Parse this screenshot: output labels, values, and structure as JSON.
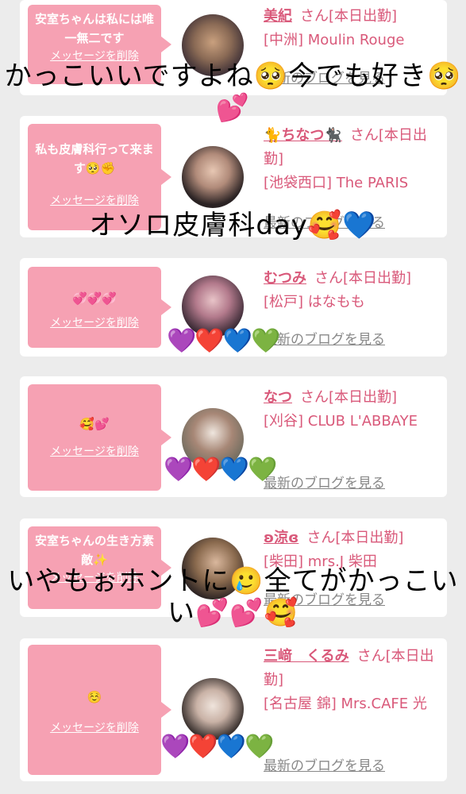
{
  "rows": [
    {
      "message": "安室ちゃんは私には唯一無二です",
      "delete_label": "メッセージを削除",
      "name": "美紀",
      "san": "さん[本日出勤]",
      "shop": "[中洲] Moulin Rouge",
      "blog": "最新のブログを見る"
    },
    {
      "message": "私も皮膚科行って来ます🥺✊",
      "delete_label": "メッセージを削除",
      "name": "🐈ちなつ🐈‍⬛",
      "san": "さん[本日出勤]",
      "shop": "[池袋西口] The PARIS",
      "blog": "最新のブログを見る"
    },
    {
      "message": "💞💞💞",
      "delete_label": "メッセージを削除",
      "name": "むつみ",
      "san": "さん[本日出勤]",
      "shop": "[松戸] はなもも",
      "blog": "最新のブログを見る"
    },
    {
      "message": "🥰💕",
      "delete_label": "メッセージを削除",
      "name": "なつ",
      "san": "さん[本日出勤]",
      "shop": "[刈谷] CLUB L'ABBAYE",
      "blog": "最新のブログを見る"
    },
    {
      "message": "安室ちゃんの生き方素敵✨",
      "delete_label": "メッセージを削除",
      "name": "ʚ涼ɞ",
      "san": "さん[本日出勤]",
      "shop": "[柴田] mrs.J 柴田",
      "blog": "最新のブログを見る"
    },
    {
      "message": "☺️",
      "delete_label": "メッセージを削除",
      "name": "三﨑　くるみ",
      "san": "さん[本日出勤]",
      "shop": "[名古屋 錦] Mrs.CAFE 光",
      "blog": "最新のブログを見る"
    }
  ],
  "overlays": {
    "caption1": "かっこいいですよね🥺今でも好き🥺💕",
    "caption2": "オソロ皮膚科day🥰💙",
    "caption3": "いやもぉホントに🥲全てがかっこいい💕💕🥰",
    "hearts": "💜❤️💙💚"
  },
  "colors": {
    "accent": "#d9597a",
    "bubble": "#f6a1b3",
    "background": "#ececec"
  }
}
